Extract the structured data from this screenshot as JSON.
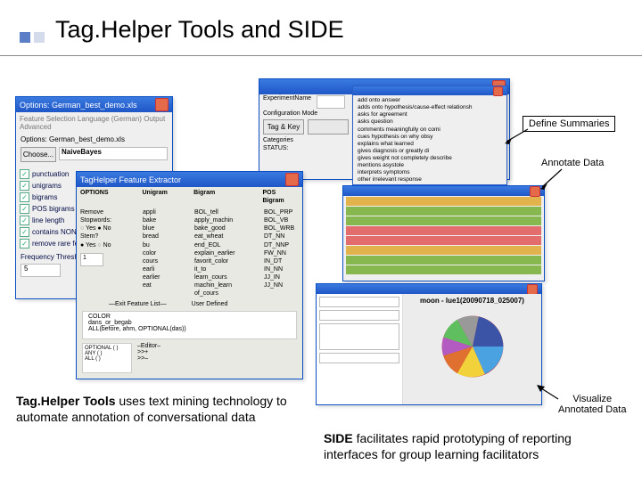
{
  "title": "Tag.Helper Tools and SIDE",
  "annotations": {
    "define": "Define Summaries",
    "annotate": "Annotate Data",
    "visualize_l1": "Visualize",
    "visualize_l2": "Annotated Data"
  },
  "left_text": {
    "bold": "Tag.Helper Tools",
    "rest": " uses text mining technology to automate annotation of conversational data"
  },
  "right_text": {
    "bold": "SIDE",
    "rest": " facilitates rapid prototyping of reporting interfaces for group learning facilitators"
  },
  "options_win": {
    "title": "Options: German_best_demo.xls",
    "file_label": "Options: German_best_demo.xls",
    "tabs": "Feature Selection  Language (German)  Output  Advanced",
    "choose": "Choose...",
    "classifier": "NaiveBayes",
    "checks": [
      "punctuation",
      "unigrams",
      "bigrams",
      "POS bigrams (slow!)",
      "line length",
      "contains NON-stop...",
      "remove rare features"
    ],
    "freq_label": "Frequency Threshold",
    "freq_value": "5"
  },
  "fe_win": {
    "title": "TagHelper Feature Extractor",
    "options": "OPTIONS",
    "remove_sw": "Remove Stopwords:",
    "stem": "Stem?",
    "yes": "Yes",
    "no": "No",
    "threshold": "1",
    "col_unigram": "Unigram",
    "col_bigram": "Bigram",
    "col_pos": "POS Bigram",
    "unigrams": "appli\nbake\nblue\nbread\nbu\ncolor\ncours\nearli\nearlier\neat",
    "bigrams": "BOL_tell\napply_machin\nbake_good\neat_wheat\nend_EOL\nexplain_earlier\nfavorit_color\nit_to\nlearn_cours\nmachin_learn\nof_cours",
    "pos": "BOL_PRP\nBOL_VB\nBOL_WRB\nDT_NN\nDT_NNP\nFW_NN\nIN_DT\nIN_NN\nJJ_IN\nJJ_NN",
    "exit": "—Exit Feature List—",
    "user_def": "User Defined",
    "colors": "COLOR\ndans_or_begab\nALL(before, ahm, OPTIONAL(das))",
    "editor": "–Editor–",
    "opt_code": "OPTIONAL ( )\nANY ( )\nALL ( )",
    "sym": ">>+\n>>–"
  },
  "summary_win": {
    "label": "ExperimentName",
    "mode": "Configuration Mode",
    "tag_key": "Tag & Key",
    "cat": "Categories",
    "status": "STATUS:",
    "items": "add onto answer\nadds onto hypothesis/cause-effect relationsh\nasks for agreement\nasks question\ncomments meaningfully on comi\ncues hypothesis on why obsy\nexplains what learned\ngives diagnosis or greatly di\ngives weight not completely describe\nmentions asystole\ninterprets symptoms\nother irrelevant response"
  },
  "annotate_win": {
    "stripes": [
      "#e2b24c",
      "#86b84f",
      "#86b84f",
      "#e36c6c",
      "#e36c6c",
      "#e2b24c",
      "#86b84f",
      "#86b84f"
    ]
  },
  "viz_win": {
    "chart_title": "moon - lue1(20090718_025007)",
    "pie_colors": [
      "#d63c3c",
      "#4aa3e0",
      "#f1d23b",
      "#e07030",
      "#b45bc2",
      "#5fbf5f",
      "#999",
      "#3b54a5"
    ]
  }
}
